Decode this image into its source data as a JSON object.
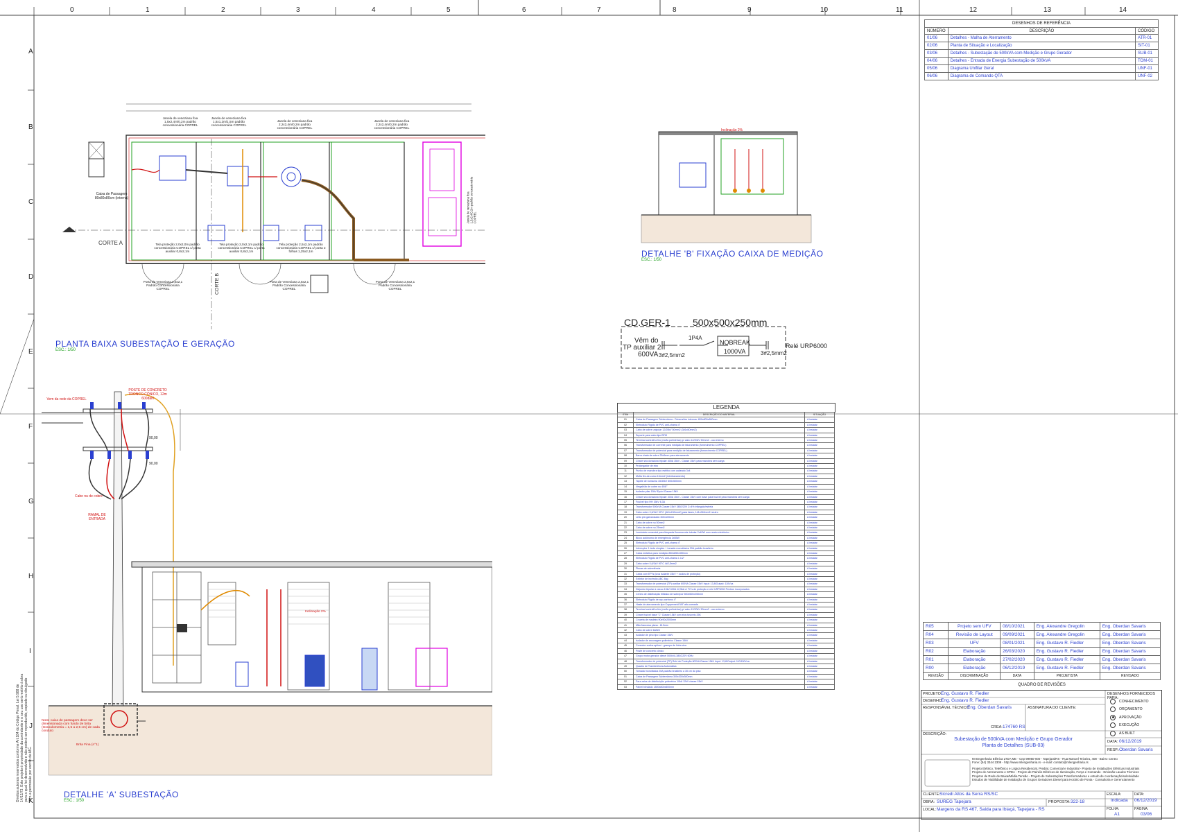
{
  "grid": {
    "cols_top": [
      "0",
      "1",
      "2",
      "3",
      "4",
      "5",
      "6",
      "7",
      "8",
      "9",
      "10",
      "11",
      "12",
      "13",
      "14"
    ],
    "rows": [
      "A",
      "B",
      "C",
      "D",
      "E",
      "F",
      "G",
      "H",
      "I",
      "J",
      "K"
    ]
  },
  "colors": {
    "blue": "#2a3fd0",
    "red": "#d01010",
    "magenta": "#e000e0",
    "green": "#20a020",
    "orange": "#e08a00",
    "line": "#333333"
  },
  "titles": {
    "planta": "PLANTA BAIXA SUBESTAÇÃO E GERAÇÃO",
    "planta_esc": "ESC.: 1/50",
    "detalhe_b": "DETALHE 'B' FIXAÇÃO CAIXA DE MEDIÇÃO",
    "detalhe_b_esc": "ESC.: 1/50",
    "detalhe_a": "DETALHE 'A' SUBESTAÇÃO",
    "detalhe_a_esc": "ESC.: 1/50"
  },
  "planta": {
    "corte_a": "CORTE A",
    "corte_b": "CORTE B",
    "caixa_passagem": "Caixa de Passagem 80x80x80cm (interna)",
    "janelas": [
      "Janela de veneziana fixa 1,5x2,4m/0,2m padrão concessionária COPREL",
      "Janela de veneziana fixa 1,5x1,2m/1,5m padrão concessionária COPREL",
      "Janela de veneziana fixa 2,2x2,4m/0,2m padrão concessionária COPREL",
      "Janela de veneziana fixa 2,2x2,4m/0,2m padrão concessionária COPREL"
    ],
    "telas": [
      "Tela proteção 2,0x2,0m padrão concessionária COPREL c/ porta auxiliar 0,8x2,1m",
      "Tela proteção 2,0x2,1m padrão concessionária COPREL c/ porta auxiliar 0,8x2,1m",
      "Tela proteção 2,5x2,1m padrão concessionária COPREL c/ porta 2 folhas 1,25x2,1m"
    ],
    "portas": [
      "Porta de Veneziana 2,5x2,1 Padrão Concessionária COPREL",
      "Porta de Veneziana 2,5x2,1 Padrão Concessionária COPREL",
      "Porta de Veneziana 2,5x2,1 Padrão Concessionária COPREL"
    ],
    "janela_lateral": "Janela de veneziana fixa 1,5x2,4/0,2m padrão concessionária COPREL"
  },
  "detalhe_b": {
    "inclinacao": "Inclinação 2%"
  },
  "cdger": {
    "title": "CD.GER-1",
    "size": "500x500x250mm",
    "vem_do": "Vêm do",
    "tp": "TP auxiliar 2",
    "va": "600VA",
    "cabo1": "3#2,5mm2",
    "disj": "1P4A",
    "nobreak": "NOBREAK",
    "nobreak_va": "1000VA",
    "cabo2": "3#2,5mm2",
    "rele": "Relé URP6000"
  },
  "detalhe_a": {
    "vem_rede": "Vem da rede da COPREL",
    "poste": "POSTE DE CONCRETO TRONCO CÔNICO, 12m 600daN",
    "cota1": "90,00",
    "cota2": "90,00",
    "cabo_cobre": "Cabo nu de cobre",
    "ramal": "RAMAL DE ENTRADA",
    "nota": "Nota: caixa de passagem deve ser dimensionada com fundo de brita (Granulometria = 1,5 a 2,5 cm) de cada conduto",
    "brita": "Brita Fina (n°1)",
    "inclinacao": "Inclinação 2%"
  },
  "side_note": "Direitos autorais reservados conforme Art.184 do Código Penal. Lei 5.988 de 14/12/73. Este projeto é propriedade da contratante e o seu uso será restrito à obra para a qual foi desenvolvido e não poderá ser reproduzido, copiado ou divulgado sem a permissão por escrito da MG.",
  "referencia": {
    "title": "DESENHOS DE REFERÊNCIA",
    "headers": [
      "NÚMERO",
      "DESCRIÇÃO",
      "CÓDIGO"
    ],
    "rows": [
      [
        "01/06",
        "Detalhes - Malha de Aterramento",
        "ATR-01"
      ],
      [
        "02/06",
        "Planta de Situação e Localização",
        "SIT-01"
      ],
      [
        "03/06",
        "Detalhes - Subestação de 500kVA com Medição e Grupo Gerador",
        "SUB-01"
      ],
      [
        "04/06",
        "Detalhes - Entrada de Energia Subestação de 500kVA",
        "TOM-01"
      ],
      [
        "05/06",
        "Diagrama Unifilar Geral",
        "UNF-01"
      ],
      [
        "06/06",
        "Diagrama de Comando QTA",
        "UNF-02"
      ]
    ]
  },
  "legenda": {
    "title": "LEGENDA",
    "headers": [
      "ITEM",
      "DESCRIÇÃO DO MATERIAL",
      "SITUAÇÃO"
    ],
    "rows": [
      [
        "01",
        "Caixa de Passagem Subterrânea - Dimensões internas: 800x800x800mm",
        "A instalar"
      ],
      [
        "02",
        "Eletroduto Rígido de PVC anti-chama 4\"",
        "A instalar"
      ],
      [
        "03",
        "Cabo de cobre unipolar 12/20kV 50mm2 (3#1x50mm2)",
        "A instalar"
      ],
      [
        "04",
        "Suporte para cabo tipo BFM",
        "A instalar"
      ],
      [
        "05",
        "Terminal contrátil a frio (mufla polimérica) p/ cabo 12/20kV 50mm2 - uso interno",
        "A instalar"
      ],
      [
        "06",
        "Transformador de corrente para medição de faturamento (fornecimento COPREL)",
        "A instalar"
      ],
      [
        "07",
        "Transformador de potencial para medição de faturamento (fornecimento COPREL)",
        "A instalar"
      ],
      [
        "08",
        "Barra chata de cobre 25x5mm para aterramento",
        "A instalar"
      ],
      [
        "09",
        "Chave seccionadora tripolar 400A 15kV - Classe 15kV para manobra sem carga",
        "A instalar"
      ],
      [
        "10",
        "Prolongador de eixo",
        "A instalar"
      ],
      [
        "11",
        "Punho de manobra tipo estribo com cadeado 3x4",
        "A instalar"
      ],
      [
        "12",
        "Mufla fim-de-curso 16mm2 (intertravamento)",
        "A instalar"
      ],
      [
        "13",
        "Tapete de borracha 15/30kV 500x500mm",
        "A instalar"
      ],
      [
        "14",
        "Vergalhão de cobre nu 40/8\"",
        "A instalar"
      ],
      [
        "15",
        "Isolador pilar 15kV Epóxi Classe 15kV",
        "A instalar"
      ],
      [
        "16",
        "Chave seccionadora tripolar 400A 15kV - Classe 15kV com base para fusível para manobra sem carga",
        "A instalar"
      ],
      [
        "17",
        "Fusível tipo HH 15kV 6,3A",
        "A instalar"
      ],
      [
        "18",
        "Transformador 500kVA Classe 15kV 380/220V Z=4% triângulo/estrela",
        "A instalar"
      ],
      [
        "19",
        "Cabo cobre 0,6/1kV 90°C (4#1x240mm2) para fases, 1#1x240mm2 neutro",
        "A instalar"
      ],
      [
        "20",
        "Leito pré-galvanizado 300x100mm",
        "A instalar"
      ],
      [
        "21",
        "Cabo de cobre nu 50mm2",
        "A instalar"
      ],
      [
        "22",
        "Cabo de cobre nu 25mm2",
        "A instalar"
      ],
      [
        "23",
        "Luminária comercial para lâmpada fluorescente tubular 2x40W com reator eletrônico",
        "A instalar"
      ],
      [
        "24",
        "Bloco autônomo de emergência 2x55W",
        "A instalar"
      ],
      [
        "25",
        "Eletroduto Rígido de PVC anti-chama 4\"",
        "A instalar"
      ],
      [
        "26",
        "Interruptor 1 tecla simples + tomada monofásica 20A padrão brasileiro",
        "A instalar"
      ],
      [
        "27",
        "Caixa metálica para medição 850x850x350mm",
        "A instalar"
      ],
      [
        "28",
        "Eletroduto Rígido de PVC anti-chama 1 1/2\"",
        "A instalar"
      ],
      [
        "29",
        "Cabo cobre 0,6/1kV 90°C 4#2,5mm2",
        "A instalar"
      ],
      [
        "30",
        "Placas de advertência",
        "A instalar"
      ],
      [
        "31",
        "Caixa com EPI's (luva isolante 15kV + óculos de proteção)",
        "A instalar"
      ],
      [
        "32",
        "Extintor de incêndio ABC 6kg",
        "A instalar"
      ],
      [
        "33",
        "Transformador de potencial (TP) auxiliar 600VA Classe 15kV Input: 13,8/Output: 110Vca",
        "A instalar"
      ],
      [
        "34",
        "Disjuntor tripolar à vácuo 15kV 630A 12,5kA c/ TC's de proteção e relé URP6000 Pextron incorporados",
        "A instalar"
      ],
      [
        "35",
        "Centro de distribuição trifásico de sobrepor 500x500x250mm",
        "A instalar"
      ],
      [
        "36",
        "Eletroduto Rígido de aço-carbono 4\"",
        "A instalar"
      ],
      [
        "37",
        "Haste de aterramento tipo Copperweld 5/8\" alto-camada",
        "A instalar"
      ],
      [
        "38",
        "Terminal contrátil a frio (mufla polimérica) p/ cabo 12/20kV 50mm2 - uso externo",
        "A instalar"
      ],
      [
        "39",
        "Chave fusível base \"C\" Classe 15kV com elos fusíveis 25K",
        "A instalar"
      ],
      [
        "40",
        "Cruzeta de madeira 90x90x2000mm",
        "A instalar"
      ],
      [
        "41",
        "Mão francesa plana - 619mm",
        "A instalar"
      ],
      [
        "42",
        "Cabo de cobre 6AWG",
        "A instalar"
      ],
      [
        "43",
        "Isolador de pino tipo Classe 15kV",
        "A instalar"
      ],
      [
        "44",
        "Isolador de ancoragem polimérico Classe 15kV",
        "A instalar"
      ],
      [
        "45",
        "Conector cunha aplica + grampo de linha viva",
        "A instalar"
      ],
      [
        "46",
        "Poste de concreto cônico",
        "A instalar"
      ],
      [
        "47",
        "Grupo motor-gerador diesel 500kVA 380/220V 60Hz",
        "A instalar"
      ],
      [
        "48",
        "Transformador de potencial (TP) Relé de Proteção 600VA Classe 15kV Input: 13,8/Output: 110/150Vca",
        "A instalar"
      ],
      [
        "49",
        "Quadro de Transferência Automática",
        "A instalar"
      ],
      [
        "50",
        "Tomada monofásica 20A padrão brasileiro a 30 cm do piso",
        "A instalar"
      ],
      [
        "51",
        "Caixa de Passagem Subterrânea 300x300x300mm",
        "A instalar"
      ],
      [
        "52",
        "Para-raios de distribuição polimérico 10kA 12kV classe 15kV",
        "A instalar"
      ],
      [
        "53",
        "Painel blindado 1800x800x800mm",
        "A instalar"
      ]
    ]
  },
  "revisoes": {
    "title": "QUADRO DE REVISÕES",
    "headers": [
      "REVISÃO",
      "DISCRIMINAÇÃO",
      "DATA",
      "PROJETISTA",
      "REVISADO"
    ],
    "rows": [
      [
        "R05",
        "Projeto sem UFV",
        "08/10/2021",
        "Eng. Alexandre Gregolin",
        "Eng. Oberdan Savaris"
      ],
      [
        "R04",
        "Revisão de Layout",
        "09/09/2021",
        "Eng. Alexandre Gregolin",
        "Eng. Oberdan Savaris"
      ],
      [
        "R03",
        "UFV",
        "08/01/2021",
        "Eng. Gustavo R. Fiedler",
        "Eng. Oberdan Savaris"
      ],
      [
        "R02",
        "Elaboração",
        "26/03/2020",
        "Eng. Gustavo R. Fiedler",
        "Eng. Oberdan Savaris"
      ],
      [
        "R01",
        "Elaboração",
        "27/02/2020",
        "Eng. Gustavo R. Fiedler",
        "Eng. Oberdan Savaris"
      ],
      [
        "R00",
        "Elaboração",
        "06/12/2019",
        "Eng. Gustavo R. Fiedler",
        "Eng. Oberdan Savaris"
      ]
    ]
  },
  "carimbo": {
    "projeto_label": "PROJETO:",
    "projeto": "Eng. Gustavo R. Fiedler",
    "desenho_label": "DESENHO:",
    "desenho": "Eng. Gustavo R. Fiedler",
    "resp_label": "RESPONSÁVEL TÉCNICO:",
    "resp": "Eng. Oberdan Savaris",
    "assinatura_label": "ASSINATURA DO CLIENTE:",
    "crea_label": "CREA:",
    "crea": "174760 RS",
    "fornecidos_label": "DESENHOS FORNECIDOS PARA:",
    "fornecidos": [
      "CONHECIMENTO",
      "ORÇAMENTO",
      "APROVAÇÃO",
      "EXECUÇÃO",
      "AS BUILT"
    ],
    "fornecido_selected": "APROVAÇÃO",
    "descricao_label": "DESCRIÇÃO:",
    "descricao1": "Subestação de 500kVA com Medição e Grupo Gerador",
    "descricao2": "Planta de Detalhes (SUB-03)",
    "data_label": "DATA:",
    "data": "06/12/2019",
    "resp2_label": "RESP.:",
    "resp2": "Oberdan Savaris",
    "empresa1": "MI Engenharia Elétrica LTDA ME - Cep 99950-000 - Tapejara/RS - Rua Manoel Teixeira, 408 - Bairro Centro",
    "empresa2": "Fone: (54) 3344 2309 - http://www.mlengenharia.rs - e-mail: contato@mlengenharia.rs",
    "servicos": [
      "Projeto Elétrico, Telefônico e Lógica Residencial, Predial, Comercial e Industrial - Projeto de Instalações Elétricas Industriais",
      "Projeto de Aterramento e SPDA - Projeto de Painéis Elétricos de Iluminação, Força e Comando - Emissão Laudos Técnicos",
      "Projetos de Rede de Baixa/Média Tensão - Projeto de Subestações Transformadoras e estudo de coordenação/seletividade",
      "Estudos de Viabilidade de Instalação de Grupos Geradores Diesel para Horário de Ponta - Consultoria e Gerenciamento"
    ],
    "cliente_label": "CLIENTE:",
    "cliente": "Sicredi Altos da Serra RS/SC",
    "obra_label": "OBRA:",
    "obra": "SUREG Tapejara",
    "proposta_label": "PROPOSTA:",
    "proposta": "322-18",
    "local_label": "LOCAL:",
    "local": "Margens da RS 467, Saída para Ibiaçá, Tapejara - RS",
    "escala_label": "ESCALA:",
    "escala": "Indicada",
    "data2_label": "DATA:",
    "data2": "06/12/2019",
    "folha_label": "FOLHA:",
    "folha": "A1",
    "pagina_label": "PÁGINA:",
    "pagina": "03/06"
  }
}
